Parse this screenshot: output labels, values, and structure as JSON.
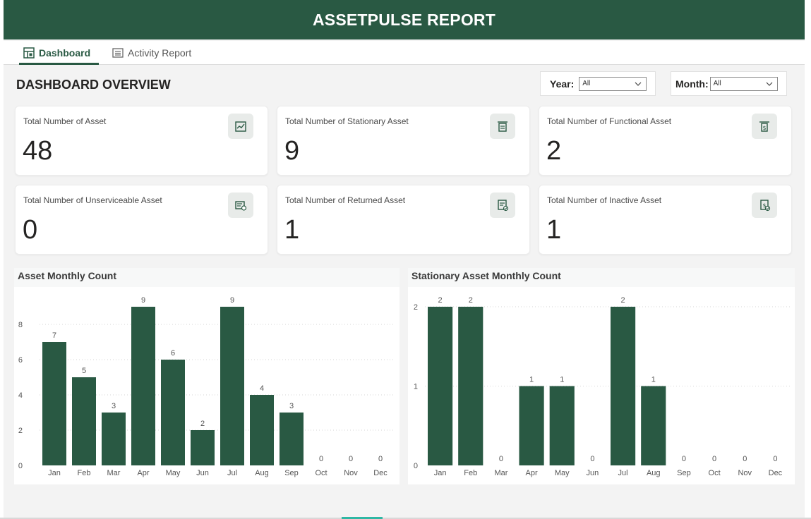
{
  "header": {
    "title": "ASSETPULSE REPORT"
  },
  "tabs": [
    {
      "label": "Dashboard",
      "icon": "dashboard-icon",
      "active": true
    },
    {
      "label": "Activity Report",
      "icon": "report-icon",
      "active": false
    }
  ],
  "overview": {
    "title": "DASHBOARD OVERVIEW"
  },
  "filters": {
    "year": {
      "label": "Year:",
      "value": "All"
    },
    "month": {
      "label": "Month:",
      "value": "All"
    }
  },
  "cards": [
    {
      "label": "Total Number of Asset",
      "value": "48",
      "icon": "asset-chart-icon"
    },
    {
      "label": "Total Number of Stationary Asset",
      "value": "9",
      "icon": "stationary-icon"
    },
    {
      "label": "Total Number of Functional Asset",
      "value": "2",
      "icon": "functional-icon"
    },
    {
      "label": "Total Number of Unserviceable Asset",
      "value": "0",
      "icon": "unserviceable-icon"
    },
    {
      "label": "Total Number of Returned Asset",
      "value": "1",
      "icon": "returned-icon"
    },
    {
      "label": "Total Number of Inactive Asset",
      "value": "1",
      "icon": "inactive-icon"
    }
  ],
  "colors": {
    "brand": "#295943",
    "bar": "#295943",
    "accent_tab": "#2fb7a4"
  },
  "chart_data": [
    {
      "type": "bar",
      "title": "Asset Monthly Count",
      "categories": [
        "Jan",
        "Feb",
        "Mar",
        "Apr",
        "May",
        "Jun",
        "Jul",
        "Aug",
        "Sep",
        "Oct",
        "Nov",
        "Dec"
      ],
      "values": [
        7,
        5,
        3,
        9,
        6,
        2,
        9,
        4,
        3,
        0,
        0,
        0
      ],
      "yticks": [
        0,
        2,
        4,
        6,
        8
      ],
      "ylim": [
        0,
        9
      ],
      "grid": true,
      "data_labels": true
    },
    {
      "type": "bar",
      "title": "Stationary Asset Monthly Count",
      "categories": [
        "Jan",
        "Feb",
        "Mar",
        "Apr",
        "May",
        "Jun",
        "Jul",
        "Aug",
        "Sep",
        "Oct",
        "Nov",
        "Dec"
      ],
      "values": [
        2,
        2,
        0,
        1,
        1,
        0,
        2,
        1,
        0,
        0,
        0,
        0
      ],
      "yticks": [
        0,
        1,
        2
      ],
      "ylim": [
        0,
        2
      ],
      "grid": true,
      "data_labels": true
    }
  ]
}
